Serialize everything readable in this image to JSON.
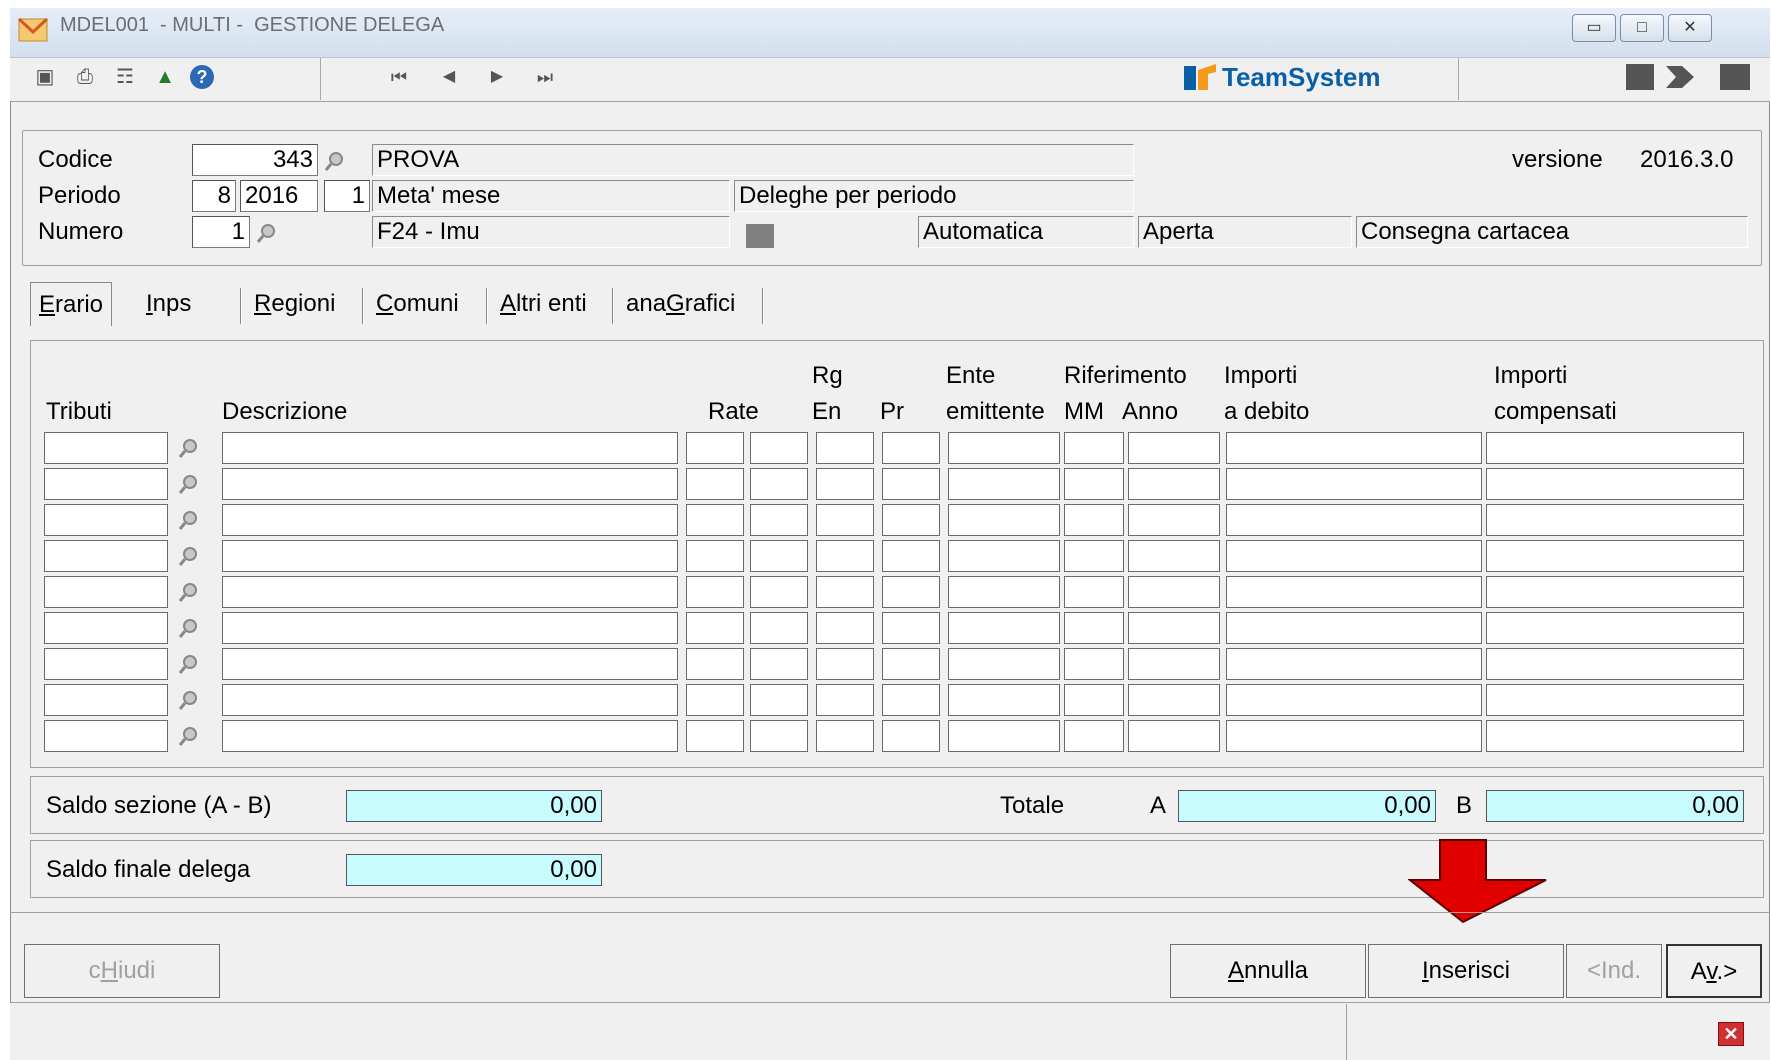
{
  "window": {
    "title": "MDEL001  - MULTI -  GESTIONE DELEGA"
  },
  "brand": {
    "name": "TeamSystem",
    "color": "#0b5fa5"
  },
  "header": {
    "codice_label": "Codice",
    "codice_value": "343",
    "codice_desc": "PROVA",
    "versione_label": "versione",
    "versione_value": "2016.3.0",
    "periodo_label": "Periodo",
    "periodo_mese": "8",
    "periodo_anno": "2016",
    "periodo_n": "1",
    "periodo_desc": "Meta' mese",
    "periodo_tipo": "Deleghe per periodo",
    "numero_label": "Numero",
    "numero_value": "1",
    "numero_desc": "F24 - Imu",
    "modalita": "Automatica",
    "stato": "Aperta",
    "consegna": "Consegna cartacea"
  },
  "tabs": [
    {
      "pre": "",
      "u": "E",
      "post": "rario"
    },
    {
      "pre": "",
      "u": "I",
      "post": "nps"
    },
    {
      "pre": "",
      "u": "R",
      "post": "egioni"
    },
    {
      "pre": "",
      "u": "C",
      "post": "omuni"
    },
    {
      "pre": "",
      "u": "A",
      "post": "ltri enti"
    },
    {
      "pre": "ana",
      "u": "G",
      "post": "rafici"
    }
  ],
  "grid": {
    "headers": {
      "tributi": "Tributi",
      "descrizione": "Descrizione",
      "rate": "Rate",
      "rg": "Rg",
      "en": "En",
      "pr": "Pr",
      "ente": "Ente",
      "emittente": "emittente",
      "riferimento": "Riferimento",
      "mm": "MM",
      "anno": "Anno",
      "importi1": "Importi",
      "debito": "a debito",
      "importi2": "Importi",
      "compensati": "compensati"
    },
    "rows": 9
  },
  "saldo": {
    "sezione_label": "Saldo sezione (A - B)",
    "sezione_value": "0,00",
    "totale_label": "Totale",
    "a_label": "A",
    "a_value": "0,00",
    "b_label": "B",
    "b_value": "0,00",
    "finale_label": "Saldo finale delega",
    "finale_value": "0,00"
  },
  "buttons": {
    "chiudi": {
      "pre": "c",
      "u": "H",
      "post": "iudi"
    },
    "annulla": {
      "pre": "",
      "u": "A",
      "post": "nnulla"
    },
    "inserisci": {
      "pre": "",
      "u": "I",
      "post": "nserisci"
    },
    "ind": "<Ind.",
    "av": {
      "pre": "A",
      "u": "v",
      "post": ".>"
    }
  },
  "annotation": {
    "arrow_color": "#e00000"
  }
}
